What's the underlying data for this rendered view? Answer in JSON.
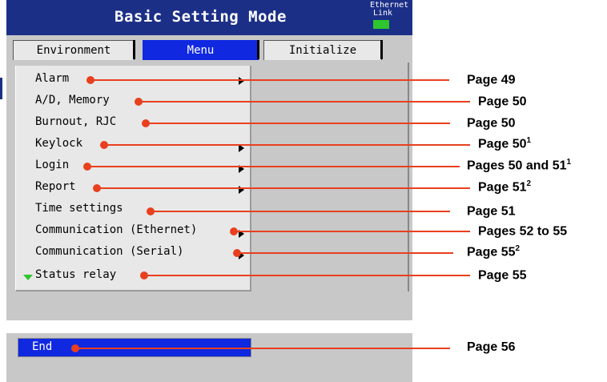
{
  "window": {
    "title": "Basic Setting Mode",
    "ethernet_label": "Ethernet",
    "link_label": "Link"
  },
  "tabs": [
    {
      "label": "Environment",
      "active": false
    },
    {
      "label": "Menu",
      "active": true
    },
    {
      "label": "Initialize",
      "active": false
    }
  ],
  "menu": {
    "items": [
      {
        "label": "Alarm",
        "submenu": true,
        "page": "Page 49",
        "sup": ""
      },
      {
        "label": "A/D, Memory",
        "submenu": false,
        "page": "Page 50",
        "sup": ""
      },
      {
        "label": "Burnout, RJC",
        "submenu": false,
        "page": "Page 50",
        "sup": ""
      },
      {
        "label": "Keylock",
        "submenu": true,
        "page": "Page 50",
        "sup": "1"
      },
      {
        "label": "Login",
        "submenu": true,
        "page": "Pages 50 and 51",
        "sup": "1"
      },
      {
        "label": "Report",
        "submenu": true,
        "page": "Page 51",
        "sup": "2"
      },
      {
        "label": "Time settings",
        "submenu": false,
        "page": "Page 51",
        "sup": ""
      },
      {
        "label": "Communication (Ethernet)",
        "submenu": true,
        "page": "Pages 52 to 55",
        "sup": ""
      },
      {
        "label": "Communication (Serial)",
        "submenu": true,
        "page": "Page 55",
        "sup": "2"
      },
      {
        "label": "Status relay",
        "submenu": false,
        "page": "Page 55",
        "sup": ""
      }
    ],
    "end_label": "End",
    "end_page": "Page 56"
  },
  "colors": {
    "title_bar": "#1c2f87",
    "active_tab": "#1028e0",
    "callout": "#e8401e",
    "link_led": "#2ec52e"
  }
}
